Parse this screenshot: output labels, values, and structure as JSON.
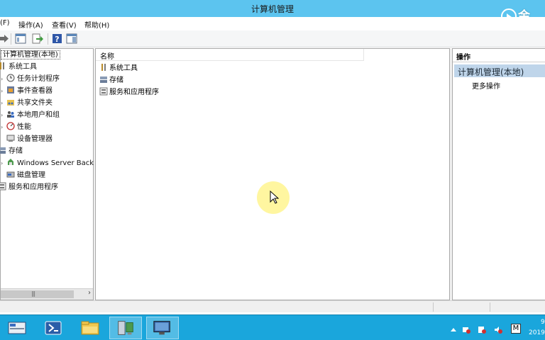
{
  "window": {
    "title": "计算机管理",
    "watermark": "金"
  },
  "menu": {
    "items": [
      "(F)",
      "操作(A)",
      "查看(V)",
      "帮助(H)"
    ]
  },
  "tree": {
    "root": "计算机管理(本地)",
    "system_tools": "系统工具",
    "children": [
      {
        "label": "任务计划程序",
        "icon": "clock-icon"
      },
      {
        "label": "事件查看器",
        "icon": "event-viewer-icon"
      },
      {
        "label": "共享文件夹",
        "icon": "shared-folder-icon"
      },
      {
        "label": "本地用户和组",
        "icon": "users-icon"
      },
      {
        "label": "性能",
        "icon": "performance-icon"
      },
      {
        "label": "设备管理器",
        "icon": "device-manager-icon"
      }
    ],
    "storage": "存储",
    "storage_children": [
      {
        "label": "Windows Server Back",
        "icon": "backup-icon"
      },
      {
        "label": "磁盘管理",
        "icon": "disk-icon"
      }
    ],
    "services": "服务和应用程序"
  },
  "list": {
    "column_name": "名称",
    "rows": [
      {
        "label": "系统工具",
        "icon": "tools-icon"
      },
      {
        "label": "存储",
        "icon": "storage-icon"
      },
      {
        "label": "服务和应用程序",
        "icon": "services-icon"
      }
    ]
  },
  "actions": {
    "header": "操作",
    "group": "计算机管理(本地)",
    "more": "更多操作"
  },
  "taskbar": {
    "clock_time": "9",
    "clock_date": "2019",
    "lang": "M"
  },
  "colors": {
    "titlebar": "#5cc4ef",
    "taskbar": "#1aa6dc",
    "action_group": "#bfd5ea"
  }
}
